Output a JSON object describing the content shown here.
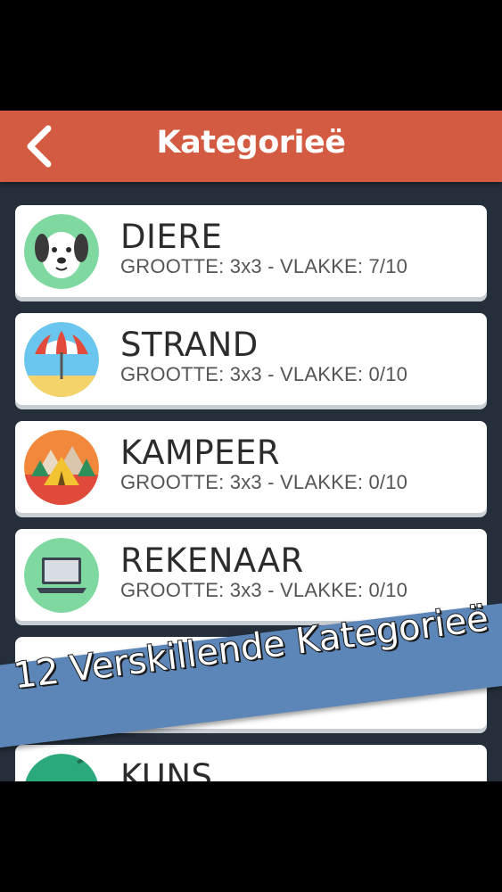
{
  "header": {
    "title": "Kategorieë"
  },
  "categories": [
    {
      "name": "DIERE",
      "details": "GROOTTE: 3x3 - VLAKKE: 7/10",
      "icon": "dog-icon",
      "color": "#7fd8a0"
    },
    {
      "name": "STRAND",
      "details": "GROOTTE: 3x3 - VLAKKE: 0/10",
      "icon": "beach-umbrella-icon",
      "color": "#6ac6ee"
    },
    {
      "name": "KAMPEER",
      "details": "GROOTTE: 3x3 - VLAKKE: 0/10",
      "icon": "tent-icon",
      "color": "#f2883b"
    },
    {
      "name": "REKENAAR",
      "details": "GROOTTE: 3x3 - VLAKKE: 0/10",
      "icon": "laptop-icon",
      "color": "#7fd8a0"
    },
    {
      "name": "KUNS",
      "details": "",
      "icon": "art-icon",
      "color": "#2aa97a"
    }
  ],
  "banner": {
    "text": "12 Verskillende Kategorieë"
  },
  "colors": {
    "header": "#d35b42",
    "background": "#242f3b",
    "banner": "#5d86b8"
  }
}
